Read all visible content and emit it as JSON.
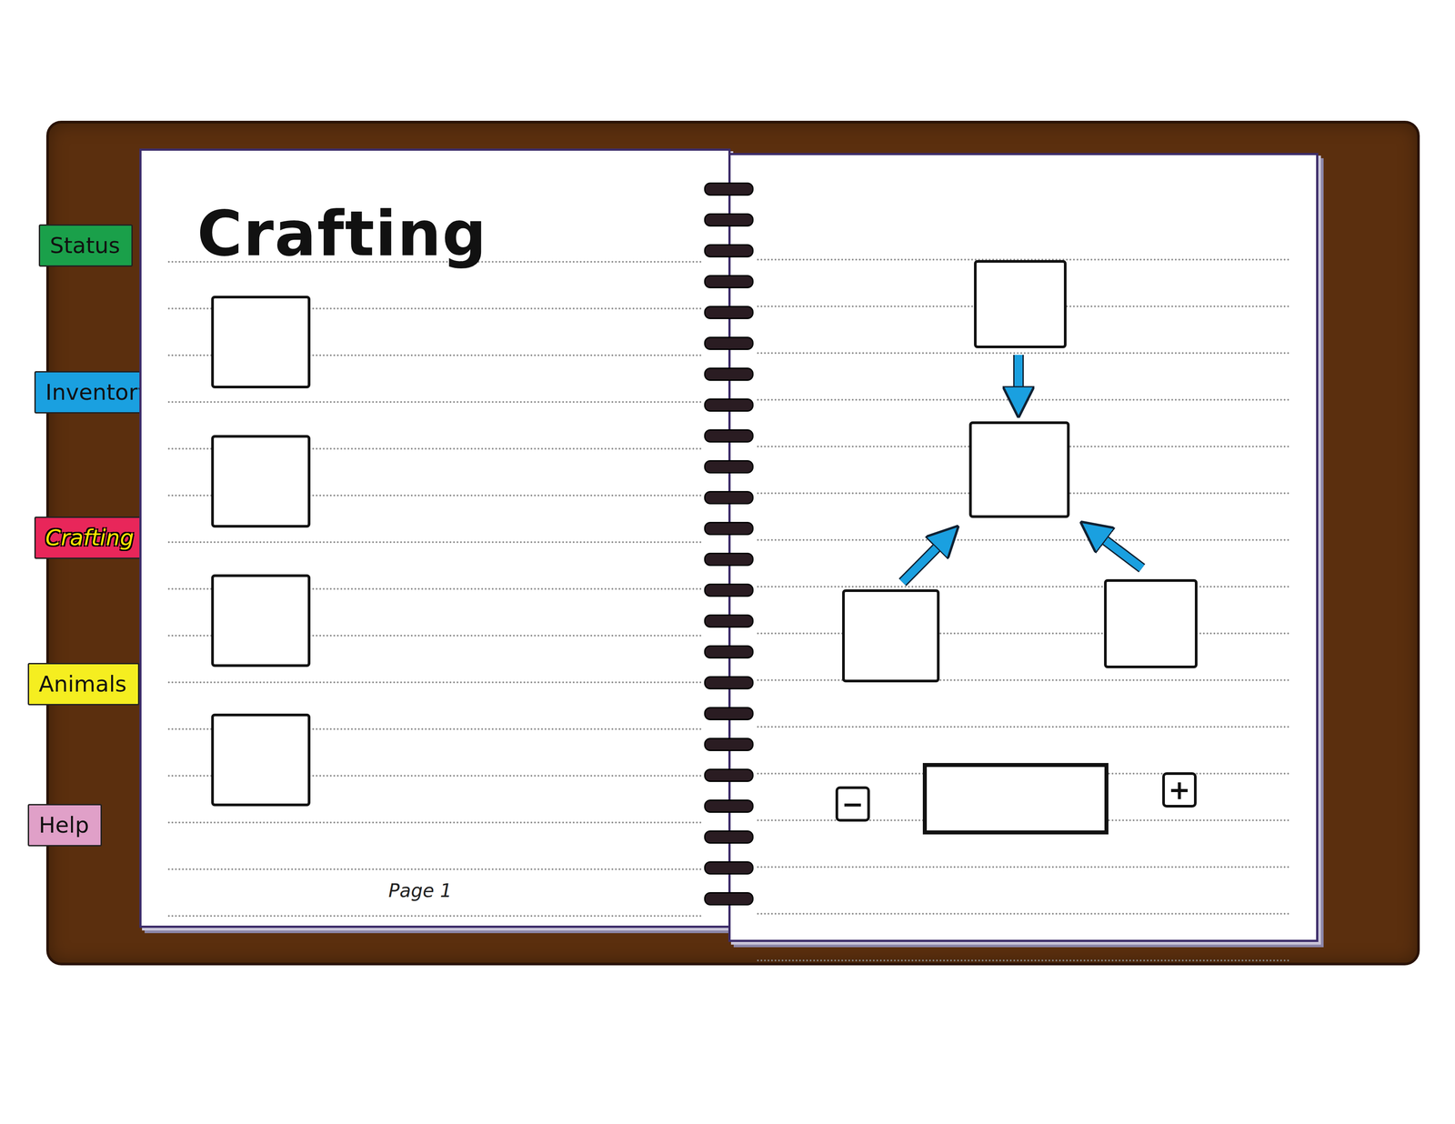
{
  "title": "Crafting",
  "tabs": [
    {
      "label": "Status",
      "selected": false,
      "color": "#1aa04a"
    },
    {
      "label": "Inventory",
      "selected": false,
      "color": "#1aa0e0"
    },
    {
      "label": "Crafting",
      "selected": true,
      "color": "#e8265a"
    },
    {
      "label": "Animals",
      "selected": false,
      "color": "#f5ee20"
    },
    {
      "label": "Help",
      "selected": false,
      "color": "#e0a0c8"
    }
  ],
  "recipe_slots": [
    {
      "empty": true
    },
    {
      "empty": true
    },
    {
      "empty": true
    },
    {
      "empty": true
    }
  ],
  "recipe_tree": [
    {
      "empty": true
    },
    {
      "empty": true
    },
    {
      "empty": true
    },
    {
      "empty": true
    }
  ],
  "quantity": {
    "minus": "−",
    "value": "",
    "plus": "+"
  },
  "page": "Page 1"
}
